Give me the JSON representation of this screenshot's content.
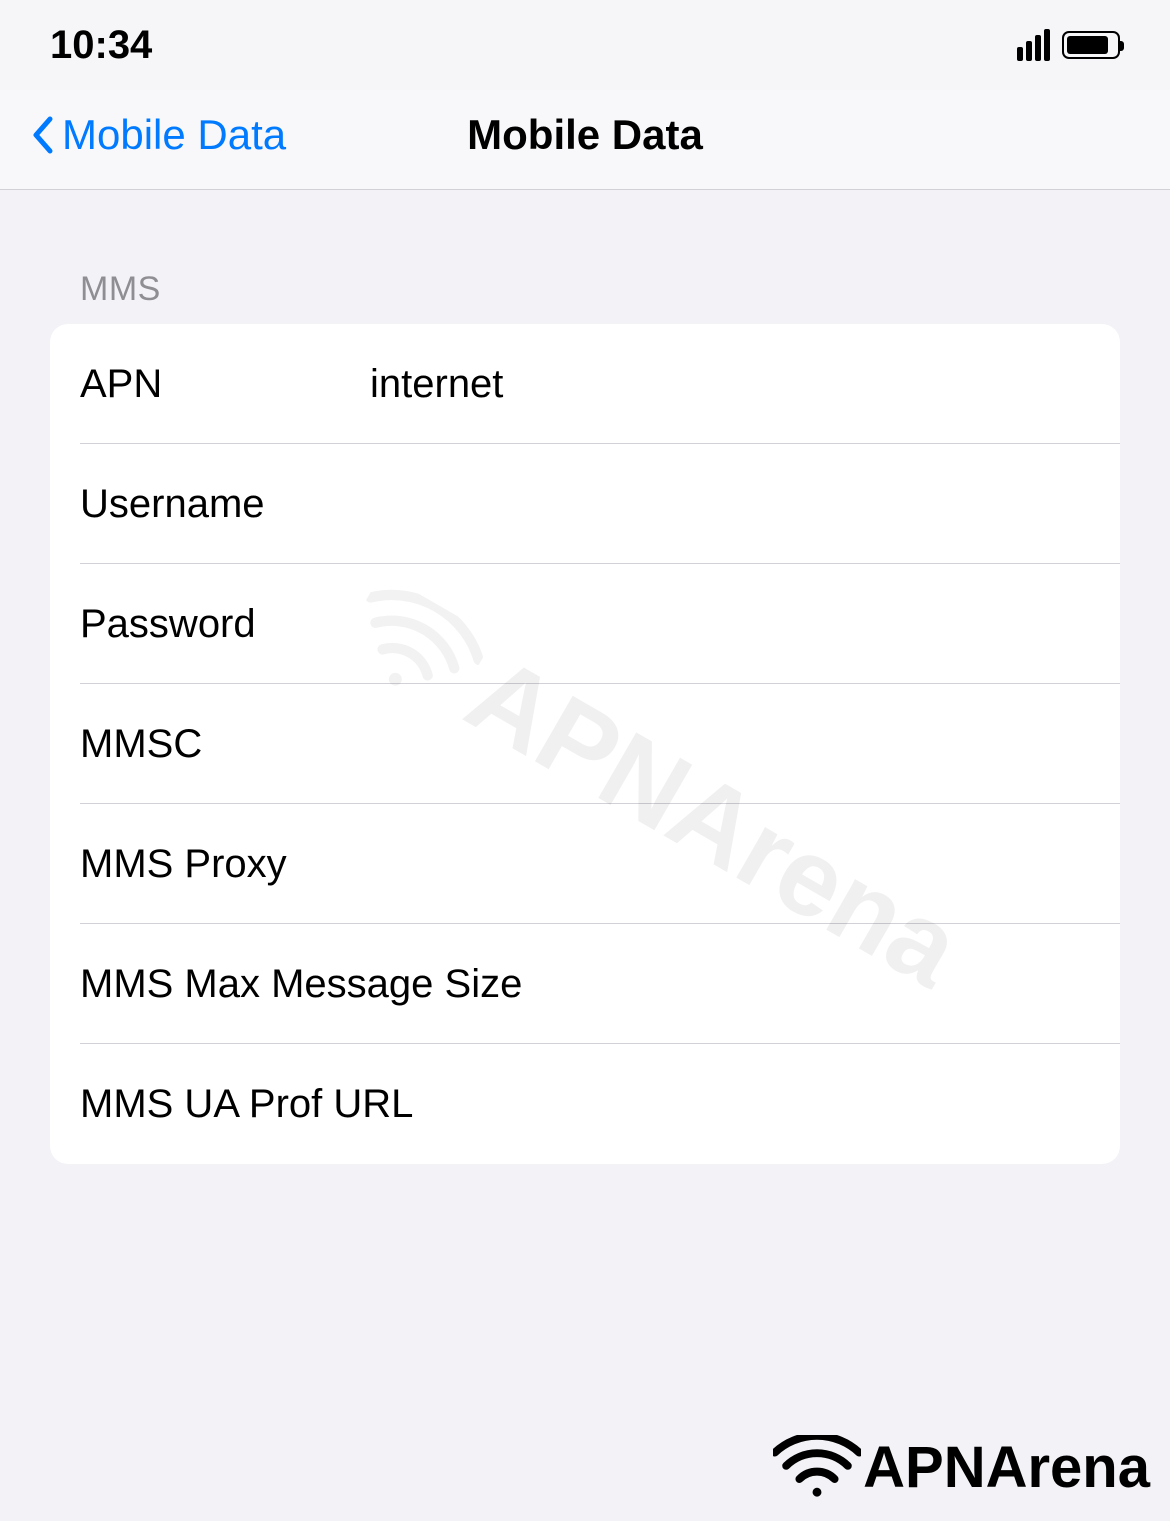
{
  "statusBar": {
    "time": "10:34"
  },
  "navBar": {
    "backLabel": "Mobile Data",
    "title": "Mobile Data"
  },
  "section": {
    "header": "MMS",
    "rows": [
      {
        "label": "APN",
        "value": "internet"
      },
      {
        "label": "Username",
        "value": ""
      },
      {
        "label": "Password",
        "value": ""
      },
      {
        "label": "MMSC",
        "value": ""
      },
      {
        "label": "MMS Proxy",
        "value": ""
      },
      {
        "label": "MMS Max Message Size",
        "value": ""
      },
      {
        "label": "MMS UA Prof URL",
        "value": ""
      }
    ]
  },
  "watermark": "APNArena",
  "footerLogo": "APNArena"
}
